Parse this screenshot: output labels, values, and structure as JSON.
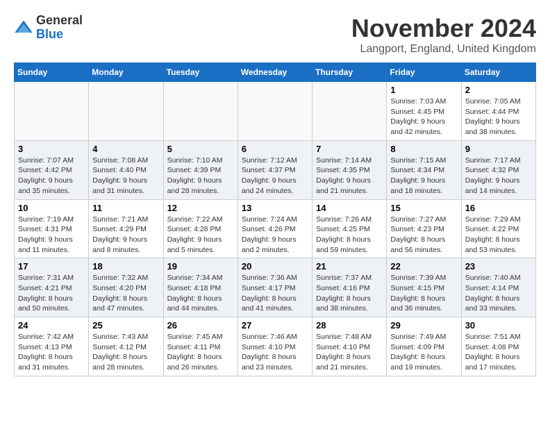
{
  "header": {
    "logo_general": "General",
    "logo_blue": "Blue",
    "month_title": "November 2024",
    "location": "Langport, England, United Kingdom"
  },
  "weekdays": [
    "Sunday",
    "Monday",
    "Tuesday",
    "Wednesday",
    "Thursday",
    "Friday",
    "Saturday"
  ],
  "weeks": [
    [
      {
        "day": "",
        "info": ""
      },
      {
        "day": "",
        "info": ""
      },
      {
        "day": "",
        "info": ""
      },
      {
        "day": "",
        "info": ""
      },
      {
        "day": "",
        "info": ""
      },
      {
        "day": "1",
        "info": "Sunrise: 7:03 AM\nSunset: 4:45 PM\nDaylight: 9 hours and 42 minutes."
      },
      {
        "day": "2",
        "info": "Sunrise: 7:05 AM\nSunset: 4:44 PM\nDaylight: 9 hours and 38 minutes."
      }
    ],
    [
      {
        "day": "3",
        "info": "Sunrise: 7:07 AM\nSunset: 4:42 PM\nDaylight: 9 hours and 35 minutes."
      },
      {
        "day": "4",
        "info": "Sunrise: 7:08 AM\nSunset: 4:40 PM\nDaylight: 9 hours and 31 minutes."
      },
      {
        "day": "5",
        "info": "Sunrise: 7:10 AM\nSunset: 4:39 PM\nDaylight: 9 hours and 28 minutes."
      },
      {
        "day": "6",
        "info": "Sunrise: 7:12 AM\nSunset: 4:37 PM\nDaylight: 9 hours and 24 minutes."
      },
      {
        "day": "7",
        "info": "Sunrise: 7:14 AM\nSunset: 4:35 PM\nDaylight: 9 hours and 21 minutes."
      },
      {
        "day": "8",
        "info": "Sunrise: 7:15 AM\nSunset: 4:34 PM\nDaylight: 9 hours and 18 minutes."
      },
      {
        "day": "9",
        "info": "Sunrise: 7:17 AM\nSunset: 4:32 PM\nDaylight: 9 hours and 14 minutes."
      }
    ],
    [
      {
        "day": "10",
        "info": "Sunrise: 7:19 AM\nSunset: 4:31 PM\nDaylight: 9 hours and 11 minutes."
      },
      {
        "day": "11",
        "info": "Sunrise: 7:21 AM\nSunset: 4:29 PM\nDaylight: 9 hours and 8 minutes."
      },
      {
        "day": "12",
        "info": "Sunrise: 7:22 AM\nSunset: 4:28 PM\nDaylight: 9 hours and 5 minutes."
      },
      {
        "day": "13",
        "info": "Sunrise: 7:24 AM\nSunset: 4:26 PM\nDaylight: 9 hours and 2 minutes."
      },
      {
        "day": "14",
        "info": "Sunrise: 7:26 AM\nSunset: 4:25 PM\nDaylight: 8 hours and 59 minutes."
      },
      {
        "day": "15",
        "info": "Sunrise: 7:27 AM\nSunset: 4:23 PM\nDaylight: 8 hours and 56 minutes."
      },
      {
        "day": "16",
        "info": "Sunrise: 7:29 AM\nSunset: 4:22 PM\nDaylight: 8 hours and 53 minutes."
      }
    ],
    [
      {
        "day": "17",
        "info": "Sunrise: 7:31 AM\nSunset: 4:21 PM\nDaylight: 8 hours and 50 minutes."
      },
      {
        "day": "18",
        "info": "Sunrise: 7:32 AM\nSunset: 4:20 PM\nDaylight: 8 hours and 47 minutes."
      },
      {
        "day": "19",
        "info": "Sunrise: 7:34 AM\nSunset: 4:18 PM\nDaylight: 8 hours and 44 minutes."
      },
      {
        "day": "20",
        "info": "Sunrise: 7:36 AM\nSunset: 4:17 PM\nDaylight: 8 hours and 41 minutes."
      },
      {
        "day": "21",
        "info": "Sunrise: 7:37 AM\nSunset: 4:16 PM\nDaylight: 8 hours and 38 minutes."
      },
      {
        "day": "22",
        "info": "Sunrise: 7:39 AM\nSunset: 4:15 PM\nDaylight: 8 hours and 36 minutes."
      },
      {
        "day": "23",
        "info": "Sunrise: 7:40 AM\nSunset: 4:14 PM\nDaylight: 8 hours and 33 minutes."
      }
    ],
    [
      {
        "day": "24",
        "info": "Sunrise: 7:42 AM\nSunset: 4:13 PM\nDaylight: 8 hours and 31 minutes."
      },
      {
        "day": "25",
        "info": "Sunrise: 7:43 AM\nSunset: 4:12 PM\nDaylight: 8 hours and 28 minutes."
      },
      {
        "day": "26",
        "info": "Sunrise: 7:45 AM\nSunset: 4:11 PM\nDaylight: 8 hours and 26 minutes."
      },
      {
        "day": "27",
        "info": "Sunrise: 7:46 AM\nSunset: 4:10 PM\nDaylight: 8 hours and 23 minutes."
      },
      {
        "day": "28",
        "info": "Sunrise: 7:48 AM\nSunset: 4:10 PM\nDaylight: 8 hours and 21 minutes."
      },
      {
        "day": "29",
        "info": "Sunrise: 7:49 AM\nSunset: 4:09 PM\nDaylight: 8 hours and 19 minutes."
      },
      {
        "day": "30",
        "info": "Sunrise: 7:51 AM\nSunset: 4:08 PM\nDaylight: 8 hours and 17 minutes."
      }
    ]
  ]
}
